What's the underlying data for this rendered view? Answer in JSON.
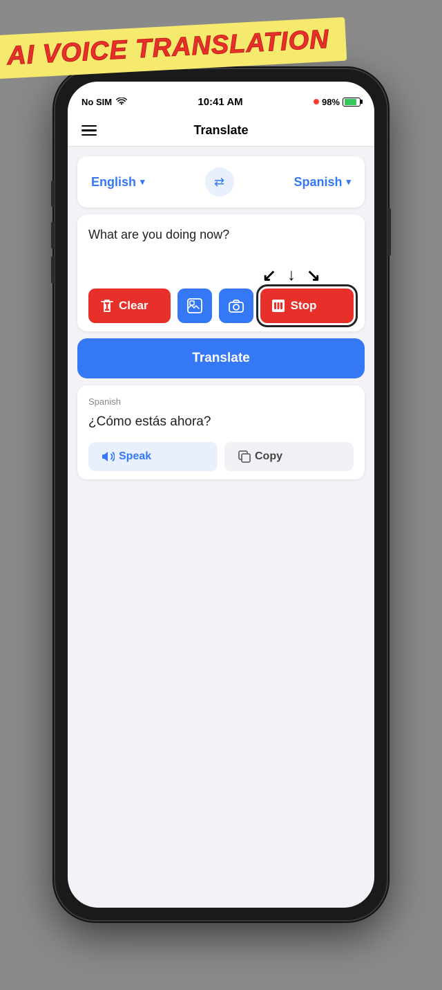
{
  "banner": {
    "text": "AI VOICE TRANSLATION"
  },
  "status_bar": {
    "carrier": "No SIM",
    "time": "10:41 AM",
    "battery": "98%"
  },
  "nav": {
    "title": "Translate"
  },
  "language_selector": {
    "source_lang": "English",
    "target_lang": "Spanish",
    "swap_icon": "⇄"
  },
  "input": {
    "text": "What are you doing now?"
  },
  "buttons": {
    "clear": "Clear",
    "stop": "Stop",
    "translate": "Translate",
    "speak": "Speak",
    "copy": "Copy"
  },
  "output": {
    "lang_label": "Spanish",
    "text": "¿Cómo estás ahora?"
  }
}
